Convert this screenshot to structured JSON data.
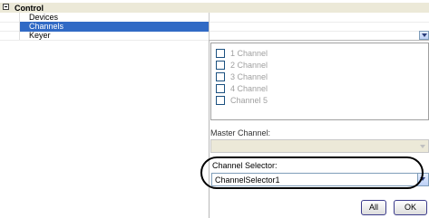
{
  "tree": {
    "header": "Control",
    "items": [
      {
        "label": "Devices",
        "selected": false
      },
      {
        "label": "Channels",
        "selected": true
      },
      {
        "label": "Keyer",
        "selected": false
      }
    ]
  },
  "panel": {
    "channels": [
      {
        "label": "1 Channel",
        "checked": false
      },
      {
        "label": "2 Channel",
        "checked": false
      },
      {
        "label": "3 Channel",
        "checked": false
      },
      {
        "label": "4 Channel",
        "checked": false
      },
      {
        "label": "Channel 5",
        "checked": false
      }
    ],
    "master_channel_label": "Master Channel:",
    "master_channel_value": "",
    "channel_selector_label": "Channel Selector:",
    "channel_selector_value": "ChannelSelector1",
    "buttons": {
      "all": "All",
      "ok": "OK"
    }
  },
  "colors": {
    "selection": "#316ac5",
    "header_bg": "#ece9d8"
  }
}
